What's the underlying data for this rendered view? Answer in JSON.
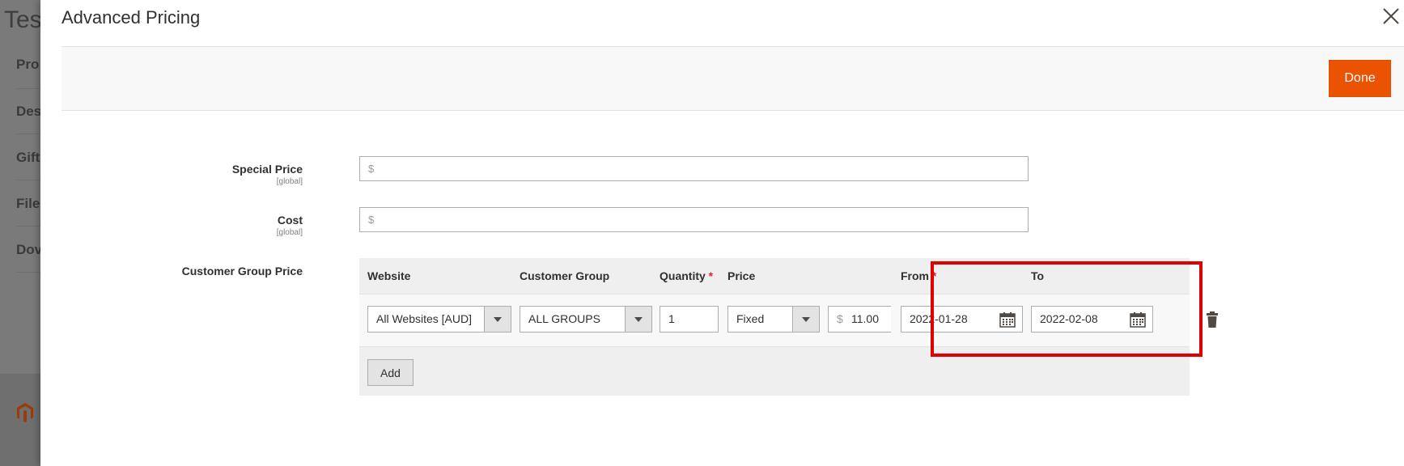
{
  "background": {
    "title": "Test",
    "items": [
      "Pro",
      "Des",
      "Gift",
      "File",
      "Dov"
    ]
  },
  "modal": {
    "title": "Advanced Pricing",
    "done_label": "Done"
  },
  "fields": {
    "special_price": {
      "label": "Special Price",
      "scope": "[global]",
      "prefix": "$",
      "value": ""
    },
    "cost": {
      "label": "Cost",
      "scope": "[global]",
      "prefix": "$",
      "value": ""
    },
    "customer_group_price": {
      "label": "Customer Group Price"
    }
  },
  "grid": {
    "headers": {
      "website": "Website",
      "customer_group": "Customer Group",
      "quantity": "Quantity",
      "price": "Price",
      "from": "From",
      "to": "To",
      "required_mark": "*"
    },
    "row": {
      "website": "All Websites [AUD]",
      "customer_group": "ALL GROUPS",
      "quantity": "1",
      "price_type": "Fixed",
      "currency": "$",
      "price": "11.00",
      "from": "2022-01-28",
      "to": "2022-02-08"
    },
    "add_label": "Add"
  },
  "colors": {
    "accent": "#eb5202",
    "highlight": "#e00000",
    "required": "#e22626"
  }
}
